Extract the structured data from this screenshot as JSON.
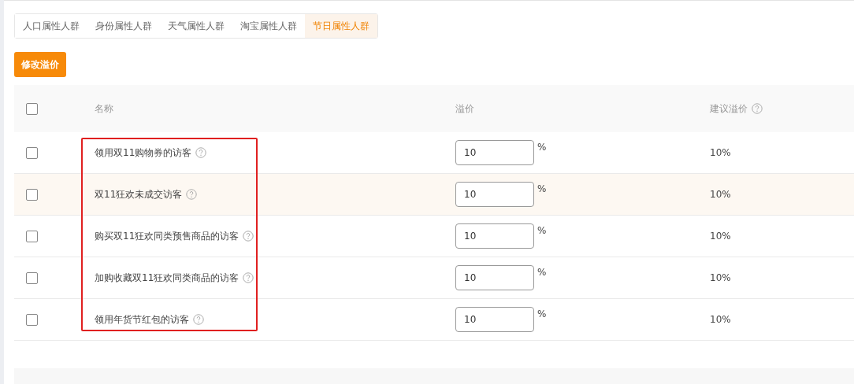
{
  "tabs": [
    {
      "label": "人口属性人群",
      "selected": false
    },
    {
      "label": "身份属性人群",
      "selected": false
    },
    {
      "label": "天气属性人群",
      "selected": false
    },
    {
      "label": "淘宝属性人群",
      "selected": false
    },
    {
      "label": "节日属性人群",
      "selected": true
    }
  ],
  "edit_button": "修改溢价",
  "table": {
    "select_all": {
      "checked": false
    },
    "columns": [
      "名称",
      "溢价",
      "建议溢价"
    ],
    "rows": [
      {
        "checked": false,
        "highlighted": false,
        "name": "领用双11购物券的访客",
        "premium": "10",
        "unit": "%",
        "suggested": "10%"
      },
      {
        "checked": false,
        "highlighted": true,
        "name": "双11狂欢未成交访客",
        "premium": "10",
        "unit": "%",
        "suggested": "10%"
      },
      {
        "checked": false,
        "highlighted": false,
        "name": "购买双11狂欢同类预售商品的访客",
        "premium": "10",
        "unit": "%",
        "suggested": "10%"
      },
      {
        "checked": false,
        "highlighted": false,
        "name": "加购收藏双11狂欢同类商品的访客",
        "premium": "10",
        "unit": "%",
        "suggested": "10%"
      },
      {
        "checked": false,
        "highlighted": false,
        "name": "领用年货节红包的访客",
        "premium": "10",
        "unit": "%",
        "suggested": "10%"
      }
    ]
  },
  "annotation": {
    "shown": true
  }
}
